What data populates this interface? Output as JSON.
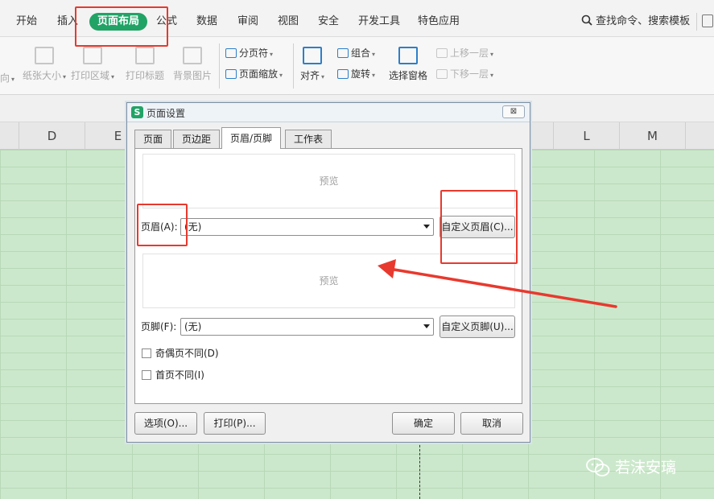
{
  "menu": {
    "items": [
      "开始",
      "插入",
      "页面布局",
      "公式",
      "数据",
      "审阅",
      "视图",
      "安全",
      "开发工具",
      "特色应用"
    ],
    "active_index": 2,
    "search_label": "查找命令、搜索模板"
  },
  "ribbon": {
    "left_cut": "向",
    "paper_size": "纸张大小",
    "print_area": "打印区域",
    "print_titles": "打印标题",
    "background": "背景图片",
    "page_break": "分页符",
    "page_zoom": "页面缩放",
    "align": "对齐",
    "group": "组合",
    "rotate": "旋转",
    "selection_pane": "选择窗格",
    "bring_forward": "上移一层",
    "send_backward": "下移一层"
  },
  "sheet": {
    "columns": [
      "D",
      "E",
      "L",
      "M"
    ]
  },
  "dialog": {
    "icon_letter": "S",
    "title": "页面设置",
    "close_label": "⊠",
    "tabs": [
      "页面",
      "页边距",
      "页眉/页脚",
      "工作表"
    ],
    "active_tab": 2,
    "header_preview": "预览",
    "header_label": "页眉(A):",
    "header_value": "(无)",
    "custom_header_button": "自定义页眉(C)...",
    "footer_preview": "预览",
    "footer_label": "页脚(F):",
    "footer_value": "(无)",
    "custom_footer_button": "自定义页脚(U)...",
    "odd_even_label": "奇偶页不同(D)",
    "first_page_label": "首页不同(I)",
    "options_button": "选项(O)...",
    "print_button": "打印(P)...",
    "ok_button": "确定",
    "cancel_button": "取消"
  },
  "watermark": {
    "text": "若沫安璃"
  },
  "colors": {
    "accent_green": "#21a366",
    "annotation_red": "#e8392e",
    "sheet_green": "#cce8cc"
  }
}
